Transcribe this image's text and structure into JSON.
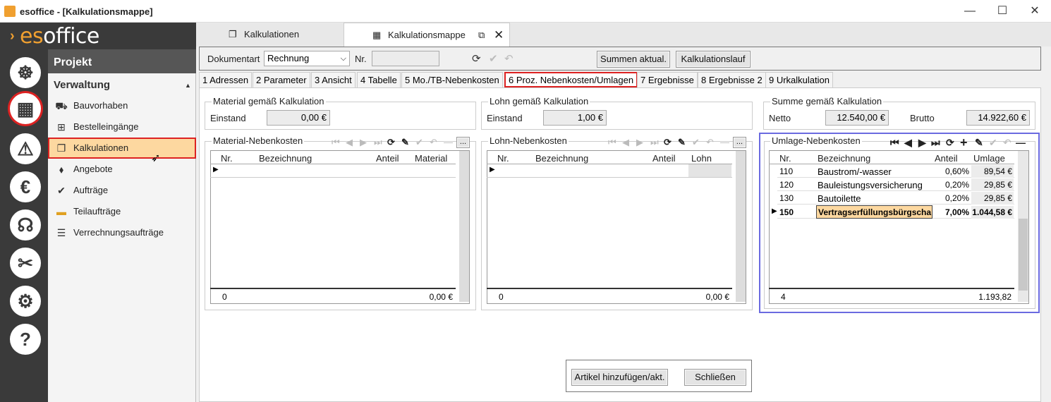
{
  "window": {
    "title": "esoffice - [Kalkulationsmappe]",
    "minimize": "—",
    "maximize": "☐",
    "close": "✕"
  },
  "logo": {
    "pre": "es",
    "post": "office"
  },
  "nav": {
    "header": "Projekt",
    "section": "Verwaltung",
    "items": [
      {
        "label": "Bauvorhaben",
        "icon": "excavator-icon"
      },
      {
        "label": "Bestelleingänge",
        "icon": "basket-icon"
      },
      {
        "label": "Kalkulationen",
        "icon": "documents-icon"
      },
      {
        "label": "Angebote",
        "icon": "tag-icon"
      },
      {
        "label": "Aufträge",
        "icon": "checkmark-icon"
      },
      {
        "label": "Teilaufträge",
        "icon": "layers-icon"
      },
      {
        "label": "Verrechnungsaufträge",
        "icon": "invoice-icon"
      }
    ]
  },
  "doctabs": [
    {
      "label": "Kalkulationen"
    },
    {
      "label": "Kalkulationsmappe"
    }
  ],
  "toolbar": {
    "doctype_label": "Dokumentart",
    "doctype_value": "Rechnung",
    "nr_label": "Nr.",
    "nr_value": "",
    "summen_btn": "Summen aktual.",
    "kalklauf_btn": "Kalkulationslauf"
  },
  "pagetabs": [
    "1 Adressen",
    "2 Parameter",
    "3 Ansicht",
    "4 Tabelle",
    "5 Mo./TB-Nebenkosten",
    "6 Proz. Nebenkosten/Umlagen",
    "7 Ergebnisse",
    "8 Ergebnisse 2",
    "9 Urkalkulation"
  ],
  "material": {
    "title": "Material gemäß Kalkulation",
    "label": "Einstand",
    "value": "0,00 €"
  },
  "lohn": {
    "title": "Lohn gemäß Kalkulation",
    "label": "Einstand",
    "value": "1,00 €"
  },
  "summe": {
    "title": "Summe gemäß Kalkulation",
    "netto_label": "Netto",
    "netto": "12.540,00 €",
    "brutto_label": "Brutto",
    "brutto": "14.922,60 €"
  },
  "matnk": {
    "title": "Material-Nebenkosten",
    "cols": [
      "Nr.",
      "Bezeichnung",
      "Anteil",
      "Material"
    ],
    "footer_count": "0",
    "footer_sum": "0,00 €",
    "more": "..."
  },
  "lohnnk": {
    "title": "Lohn-Nebenkosten",
    "cols": [
      "Nr.",
      "Bezeichnung",
      "Anteil",
      "Lohn"
    ],
    "footer_count": "0",
    "footer_sum": "0,00 €",
    "more": "..."
  },
  "umlage": {
    "title": "Umlage-Nebenkosten",
    "cols": [
      "Nr.",
      "Bezeichnung",
      "Anteil",
      "Umlage"
    ],
    "rows": [
      {
        "nr": "110",
        "bez": "Baustrom/-wasser",
        "anteil": "0,60%",
        "umlage": "89,54 €"
      },
      {
        "nr": "120",
        "bez": "Bauleistungsversicherung",
        "anteil": "0,20%",
        "umlage": "29,85 €"
      },
      {
        "nr": "130",
        "bez": "Bautoilette",
        "anteil": "0,20%",
        "umlage": "29,85 €"
      },
      {
        "nr": "150",
        "bez": "Vertragserfüllungsbürgscha",
        "anteil": "7,00%",
        "umlage": "1.044,58 €"
      }
    ],
    "footer_count": "4",
    "footer_sum": "1.193,82"
  },
  "bottom": {
    "add_btn": "Artikel hinzufügen/akt.",
    "close_btn": "Schließen"
  }
}
